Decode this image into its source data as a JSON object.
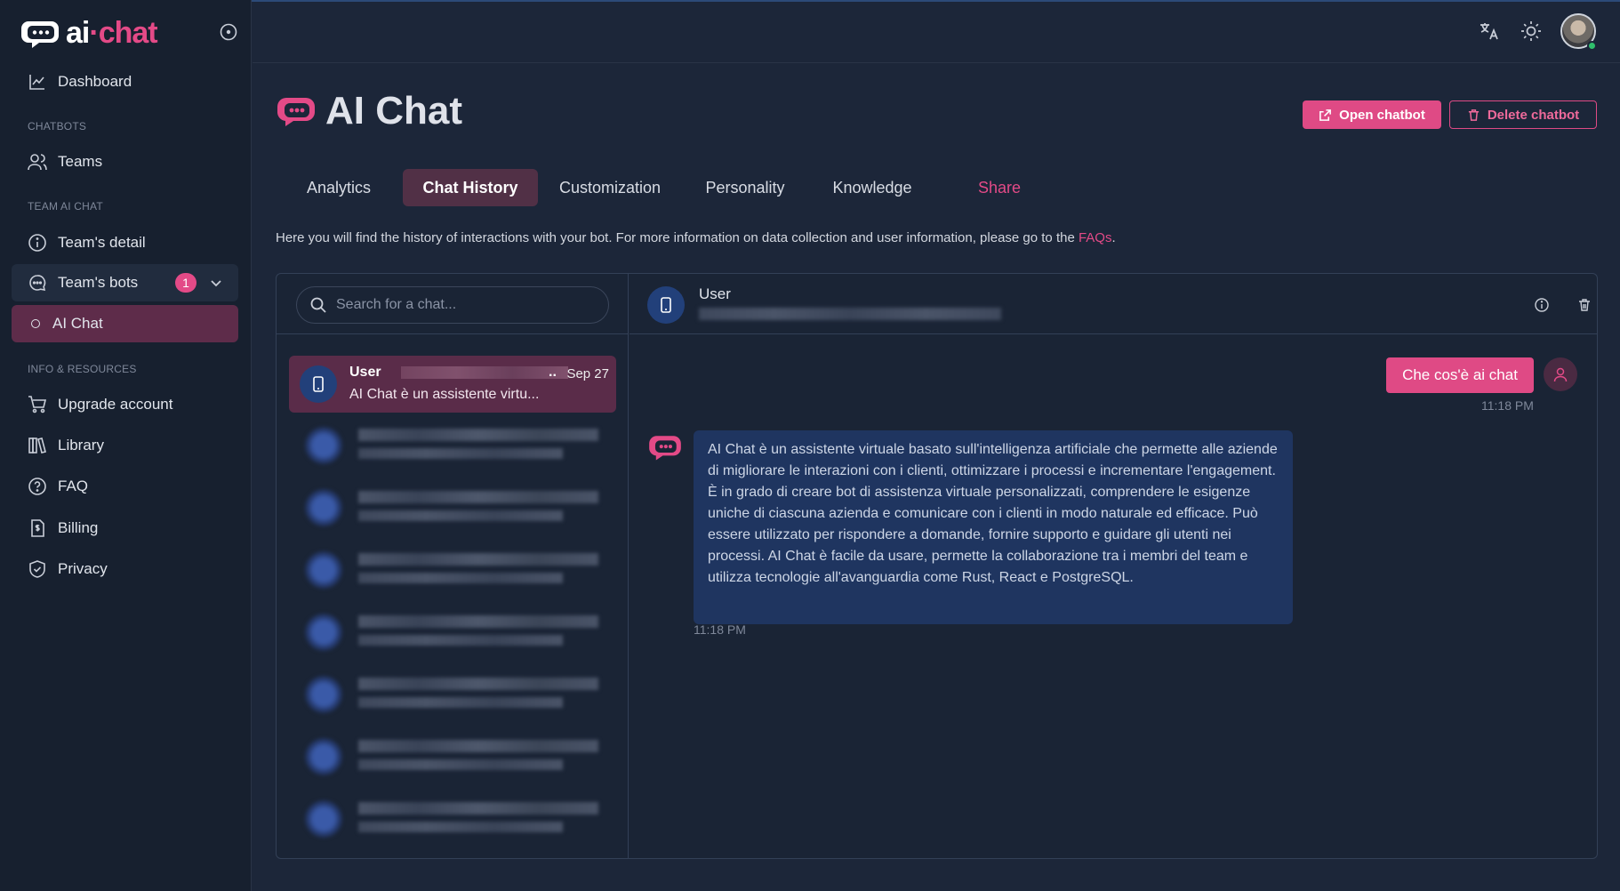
{
  "app": {
    "logo": {
      "ai": "ai",
      "dot": "·",
      "chat": "chat"
    }
  },
  "sidebar": {
    "dashboard": "Dashboard",
    "section_chatbots": "CHATBOTS",
    "teams": "Teams",
    "section_team": "TEAM AI CHAT",
    "teams_detail": "Team's detail",
    "teams_bots": "Team's bots",
    "teams_bots_badge": "1",
    "ai_chat": "AI Chat",
    "section_info": "INFO & RESOURCES",
    "upgrade": "Upgrade account",
    "library": "Library",
    "faq": "FAQ",
    "billing": "Billing",
    "privacy": "Privacy"
  },
  "header": {
    "title": "AI Chat",
    "open_chatbot": "Open chatbot",
    "delete_chatbot": "Delete chatbot"
  },
  "tabs": [
    {
      "label": "Analytics",
      "active": false
    },
    {
      "label": "Chat History",
      "active": true
    },
    {
      "label": "Customization",
      "active": false
    },
    {
      "label": "Personality",
      "active": false
    },
    {
      "label": "Knowledge",
      "active": false
    },
    {
      "label": "Share",
      "active": false
    }
  ],
  "intro": {
    "text": "Here you will find the history of interactions with your bot. For more information on data collection and user information, please go to the ",
    "link": "FAQs",
    "suffix": "."
  },
  "chat_list": {
    "search_placeholder": "Search for a chat...",
    "selected": {
      "user": "User",
      "ellipsis": "..",
      "date": "Sep 27",
      "preview": "AI Chat è un assistente virtu..."
    }
  },
  "conversation": {
    "user": "User",
    "messages": [
      {
        "from": "user",
        "text": "Che cos'è ai chat",
        "time": "11:18 PM"
      },
      {
        "from": "bot",
        "text": "AI Chat è un assistente virtuale basato sull'intelligenza artificiale che permette alle aziende di migliorare le interazioni con i clienti, ottimizzare i processi e incrementare l'engagement. È in grado di creare bot di assistenza virtuale personalizzati, comprendere le esigenze uniche di ciascuna azienda e comunicare con i clienti in modo naturale ed efficace. Può essere utilizzato per rispondere a domande, fornire supporto e guidare gli utenti nei processi. AI Chat è facile da usare, permette la collaborazione tra i membri del team e utilizza tecnologie all'avanguardia come Rust, React e PostgreSQL.",
        "time": "11:18 PM"
      }
    ]
  },
  "colors": {
    "accent": "#e34a87",
    "background": "#1c2639",
    "sidebar": "#17202f",
    "bot_bubble": "#1f3560"
  }
}
